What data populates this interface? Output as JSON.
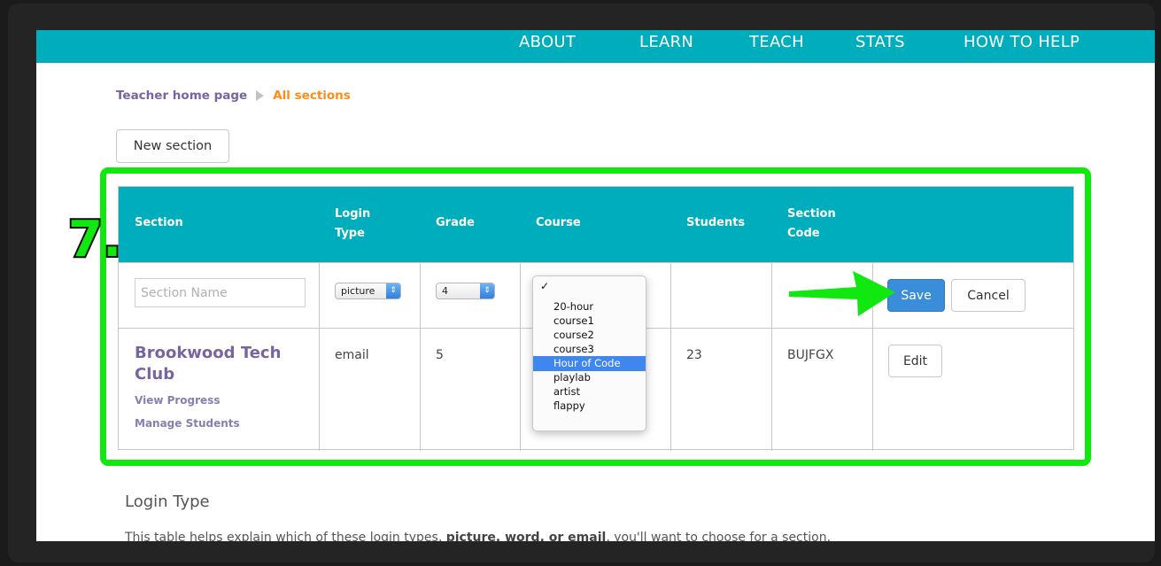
{
  "nav": {
    "items": [
      "ABOUT",
      "LEARN",
      "TEACH",
      "STATS",
      "HOW TO HELP"
    ]
  },
  "breadcrumb": {
    "home": "Teacher home page",
    "current": "All sections"
  },
  "new_section_label": "New section",
  "table": {
    "headers": {
      "section": "Section",
      "login_type": "Login Type",
      "grade": "Grade",
      "course": "Course",
      "students": "Students",
      "section_code": "Section Code"
    },
    "edit_row": {
      "name_placeholder": "Section Name",
      "login_type": "picture",
      "grade": "4",
      "save_label": "Save",
      "cancel_label": "Cancel"
    },
    "rows": [
      {
        "name": "Brookwood Tech Club",
        "view_progress": "View Progress",
        "manage_students": "Manage Students",
        "login_type": "email",
        "grade": "5",
        "students": "23",
        "code": "BUJFGX",
        "edit_label": "Edit"
      }
    ]
  },
  "course_dropdown": {
    "check": "✓",
    "options": [
      "20-hour",
      "course1",
      "course2",
      "course3",
      "Hour of Code",
      "playlab",
      "artist",
      "flappy"
    ],
    "selected": "Hour of Code"
  },
  "login_section": {
    "heading": "Login Type",
    "desc_prefix": "This table helps explain which of these login types, ",
    "desc_bold": "picture, word, or email",
    "desc_suffix": ", you'll want to choose for a section."
  },
  "annotation": {
    "step": "7.",
    "color": "#10e810"
  },
  "colors": {
    "teal": "#00adbc",
    "purple": "#7665a0",
    "orange": "#ff8c1a",
    "save_blue": "#3a8dd8",
    "highlight_blue": "#3f86f1"
  }
}
